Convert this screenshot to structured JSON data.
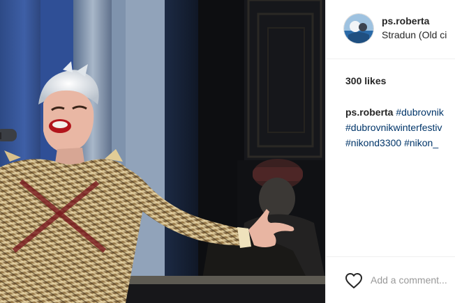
{
  "post": {
    "username": "ps.roberta",
    "location": "Stradun (Old ci",
    "likes": "300 likes",
    "caption": {
      "username": "ps.roberta",
      "lines": [
        [
          "#dubrovnik"
        ],
        [
          "#dubrovnikwinterfestiv"
        ],
        [
          "#nikond3300",
          "#nikon_"
        ]
      ]
    },
    "comment_placeholder": "Add a comment..."
  },
  "colors": {
    "link": "#003569",
    "text": "#262626",
    "placeholder": "#999999",
    "divider": "#efefef"
  },
  "icons": {
    "like": "heart-outline-icon"
  }
}
